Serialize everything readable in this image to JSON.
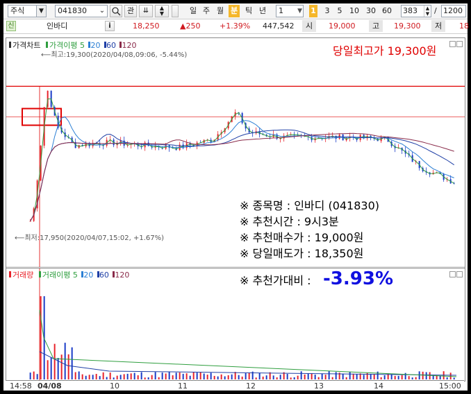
{
  "toolbar": {
    "market": "주식",
    "code": "041830",
    "btn_gwan": "관",
    "periods": [
      "일",
      "주",
      "월",
      "분",
      "틱",
      "년"
    ],
    "active_period": "분",
    "interval_value": "1",
    "minute_badge": "1",
    "intervals": [
      "3",
      "5",
      "10",
      "30",
      "60"
    ],
    "count_value": "383",
    "count_sep": "/",
    "count_total": "1200"
  },
  "quote": {
    "badge": "신",
    "name": "인바디",
    "info_icon": "i",
    "price": "18,250",
    "change": "▲250",
    "change_pct": "+1.39%",
    "volume": "447,542",
    "open_label": "시",
    "open": "19,000",
    "high_label": "고",
    "high": "19,300",
    "low_label": "저",
    "low": "18"
  },
  "price_panel": {
    "legend": {
      "title": "가격차트",
      "ma_label": "가격이평",
      "ma5": "5",
      "ma20": "20",
      "ma60": "60",
      "ma120": "120"
    },
    "high_note": "최고:19,300(2020/04/08,09:06, -5.44%)",
    "low_note": "최저:17,950(2020/04/07,15:02, +1.67%)",
    "headline": "당일최고가 19,300원"
  },
  "volume_panel": {
    "legend": {
      "title": "거래량",
      "ma_label": "거래이평",
      "ma5": "5",
      "ma20": "20",
      "ma60": "60",
      "ma120": "120"
    }
  },
  "x_axis": [
    "14:58",
    "04/08",
    "10",
    "11",
    "12",
    "13",
    "14",
    "15:00"
  ],
  "info": {
    "line1": "※ 종목명 : 인바디 (041830)",
    "line2": "※ 추천시간 : 9시3분",
    "line3": "※ 추천매수가 : 19,000원",
    "line4": "※ 당일매도가 : 18,350원",
    "line5_label": "※ 추천가대비 :",
    "line5_value": "-3.93%"
  },
  "colors": {
    "up": "#e8232b",
    "down": "#1a3cc8",
    "ma5": "#2e9e3e",
    "ma20": "#2b7fd4",
    "ma60": "#1f3fa6",
    "ma120": "#8a2b4a",
    "active_period": "#f5b72a",
    "highlight": "#e00000"
  },
  "chart_data": {
    "type": "candlestick",
    "interval": "1 minute",
    "x_ticks": [
      "14:58",
      "04/08",
      "10",
      "11",
      "12",
      "13",
      "14",
      "15:00"
    ],
    "ylim": [
      17800,
      19500
    ],
    "price_series": [
      {
        "time": "04/07 14:58",
        "price": 17980
      },
      {
        "time": "04/07 15:00",
        "price": 18000
      },
      {
        "time": "04/08 09:00",
        "price": 18600
      },
      {
        "time": "04/08 09:03",
        "price": 19000
      },
      {
        "time": "04/08 09:06",
        "price": 19300
      },
      {
        "time": "04/08 09:15",
        "price": 18900
      },
      {
        "time": "04/08 09:30",
        "price": 18720
      },
      {
        "time": "04/08 10:00",
        "price": 18750
      },
      {
        "time": "04/08 10:30",
        "price": 18720
      },
      {
        "time": "04/08 11:00",
        "price": 18700
      },
      {
        "time": "04/08 11:30",
        "price": 18780
      },
      {
        "time": "04/08 11:50",
        "price": 19050
      },
      {
        "time": "04/08 12:00",
        "price": 18850
      },
      {
        "time": "04/08 12:30",
        "price": 18800
      },
      {
        "time": "04/08 13:00",
        "price": 18800
      },
      {
        "time": "04/08 13:30",
        "price": 18800
      },
      {
        "time": "04/08 14:00",
        "price": 18780
      },
      {
        "time": "04/08 14:30",
        "price": 18500
      },
      {
        "time": "04/08 15:00",
        "price": 18350
      }
    ],
    "annotations": [
      {
        "label": "최고",
        "value": 19300,
        "time": "2020/04/08 09:06",
        "change": "-5.44%"
      },
      {
        "label": "최저",
        "value": 17950,
        "time": "2020/04/07 15:02",
        "change": "+1.67%"
      }
    ]
  }
}
